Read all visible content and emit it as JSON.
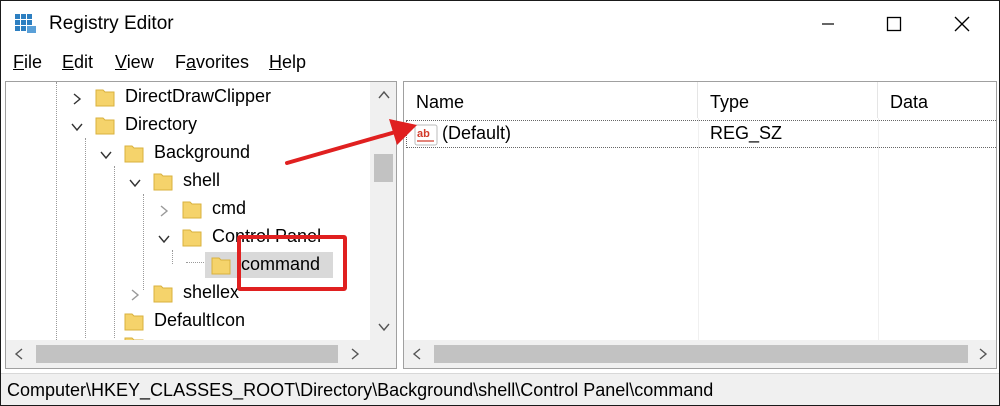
{
  "window": {
    "title": "Registry Editor",
    "icon": "registry-editor-icon"
  },
  "menu": [
    {
      "label": "File",
      "underline": "F",
      "rest": "ile"
    },
    {
      "label": "Edit",
      "underline": "E",
      "rest": "dit"
    },
    {
      "label": "View",
      "underline": "V",
      "rest": "iew"
    },
    {
      "label": "Favorites",
      "underline": "a",
      "pre": "F",
      "rest": "vorites"
    },
    {
      "label": "Help",
      "underline": "H",
      "rest": "elp"
    }
  ],
  "tree": {
    "items": [
      {
        "label": "DirectDrawClipper",
        "expanded": false
      },
      {
        "label": "Directory",
        "expanded": true
      },
      {
        "label": "Background",
        "expanded": true
      },
      {
        "label": "shell",
        "expanded": true
      },
      {
        "label": "cmd",
        "expanded": false
      },
      {
        "label": "Control Panel",
        "expanded": true
      },
      {
        "label": "command",
        "selected": true
      },
      {
        "label": "shellex",
        "expanded": false
      },
      {
        "label": "DefaultIcon"
      }
    ]
  },
  "list": {
    "columns": [
      "Name",
      "Type",
      "Data"
    ],
    "rows": [
      {
        "name": "(Default)",
        "type": "REG_SZ",
        "data": "",
        "icon": "string-value-icon"
      }
    ]
  },
  "status": {
    "path": "Computer\\HKEY_CLASSES_ROOT\\Directory\\Background\\shell\\Control Panel\\command"
  },
  "colors": {
    "annotation": "#e02020",
    "folder": "#f5d36b",
    "selection": "#d9d9d9"
  }
}
